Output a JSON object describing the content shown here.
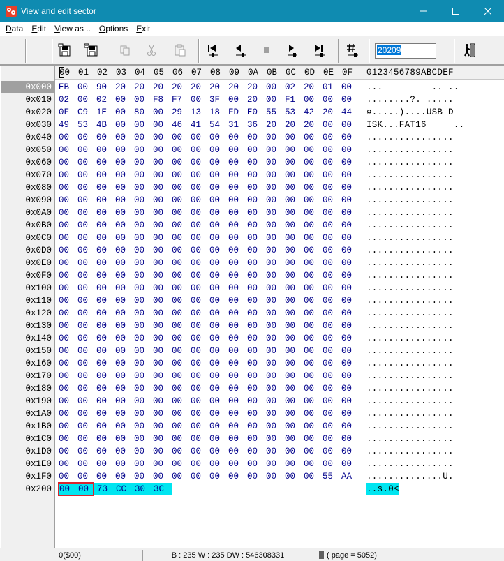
{
  "window": {
    "title": "View and edit sector",
    "app_icon": "app-logo-icon",
    "controls": [
      "minimize-icon",
      "maximize-icon",
      "close-icon"
    ]
  },
  "menu": [
    {
      "label": "Data",
      "u": "D",
      "rest": "ata"
    },
    {
      "label": "Edit",
      "u": "E",
      "rest": "dit"
    },
    {
      "label": "View as ..",
      "u": "V",
      "rest": "iew as .."
    },
    {
      "label": "Options",
      "u": "O",
      "rest": "ptions"
    },
    {
      "label": "Exit",
      "u": "E",
      "rest": "xit"
    }
  ],
  "toolbar": {
    "icons": [
      "save-sector-icon",
      "save-as-icon",
      "copy-icon",
      "cut-icon",
      "paste-icon",
      "first-sector-icon",
      "previous-sector-icon",
      "stop-icon",
      "next-sector-icon",
      "last-sector-icon",
      "goto-sector-icon",
      "exit-door-icon"
    ],
    "sector_value": "20209"
  },
  "header": {
    "columns": [
      "00",
      "01",
      "02",
      "03",
      "04",
      "05",
      "06",
      "07",
      "08",
      "09",
      "0A",
      "0B",
      "0C",
      "0D",
      "0E",
      "0F"
    ],
    "ascii": "0123456789ABCDEF"
  },
  "rows": [
    {
      "addr": "0x000",
      "bytes": [
        "EB",
        "00",
        "90",
        "20",
        "20",
        "20",
        "20",
        "20",
        "20",
        "20",
        "20",
        "00",
        "02",
        "20",
        "01",
        "00"
      ],
      "ascii": "...         .. .."
    },
    {
      "addr": "0x010",
      "bytes": [
        "02",
        "00",
        "02",
        "00",
        "00",
        "F8",
        "F7",
        "00",
        "3F",
        "00",
        "20",
        "00",
        "F1",
        "00",
        "00",
        "00"
      ],
      "ascii": "........?. ....."
    },
    {
      "addr": "0x020",
      "bytes": [
        "0F",
        "C9",
        "1E",
        "00",
        "80",
        "00",
        "29",
        "13",
        "18",
        "FD",
        "E0",
        "55",
        "53",
        "42",
        "20",
        "44"
      ],
      "ascii": "¤.....)....USB D"
    },
    {
      "addr": "0x030",
      "bytes": [
        "49",
        "53",
        "4B",
        "00",
        "00",
        "00",
        "46",
        "41",
        "54",
        "31",
        "36",
        "20",
        "20",
        "20",
        "00",
        "00"
      ],
      "ascii": "ISK...FAT16     .."
    },
    {
      "addr": "0x040",
      "bytes": [
        "00",
        "00",
        "00",
        "00",
        "00",
        "00",
        "00",
        "00",
        "00",
        "00",
        "00",
        "00",
        "00",
        "00",
        "00",
        "00"
      ],
      "ascii": "................"
    },
    {
      "addr": "0x050",
      "bytes": [
        "00",
        "00",
        "00",
        "00",
        "00",
        "00",
        "00",
        "00",
        "00",
        "00",
        "00",
        "00",
        "00",
        "00",
        "00",
        "00"
      ],
      "ascii": "................"
    },
    {
      "addr": "0x060",
      "bytes": [
        "00",
        "00",
        "00",
        "00",
        "00",
        "00",
        "00",
        "00",
        "00",
        "00",
        "00",
        "00",
        "00",
        "00",
        "00",
        "00"
      ],
      "ascii": "................"
    },
    {
      "addr": "0x070",
      "bytes": [
        "00",
        "00",
        "00",
        "00",
        "00",
        "00",
        "00",
        "00",
        "00",
        "00",
        "00",
        "00",
        "00",
        "00",
        "00",
        "00"
      ],
      "ascii": "................"
    },
    {
      "addr": "0x080",
      "bytes": [
        "00",
        "00",
        "00",
        "00",
        "00",
        "00",
        "00",
        "00",
        "00",
        "00",
        "00",
        "00",
        "00",
        "00",
        "00",
        "00"
      ],
      "ascii": "................"
    },
    {
      "addr": "0x090",
      "bytes": [
        "00",
        "00",
        "00",
        "00",
        "00",
        "00",
        "00",
        "00",
        "00",
        "00",
        "00",
        "00",
        "00",
        "00",
        "00",
        "00"
      ],
      "ascii": "................"
    },
    {
      "addr": "0x0A0",
      "bytes": [
        "00",
        "00",
        "00",
        "00",
        "00",
        "00",
        "00",
        "00",
        "00",
        "00",
        "00",
        "00",
        "00",
        "00",
        "00",
        "00"
      ],
      "ascii": "................"
    },
    {
      "addr": "0x0B0",
      "bytes": [
        "00",
        "00",
        "00",
        "00",
        "00",
        "00",
        "00",
        "00",
        "00",
        "00",
        "00",
        "00",
        "00",
        "00",
        "00",
        "00"
      ],
      "ascii": "................"
    },
    {
      "addr": "0x0C0",
      "bytes": [
        "00",
        "00",
        "00",
        "00",
        "00",
        "00",
        "00",
        "00",
        "00",
        "00",
        "00",
        "00",
        "00",
        "00",
        "00",
        "00"
      ],
      "ascii": "................"
    },
    {
      "addr": "0x0D0",
      "bytes": [
        "00",
        "00",
        "00",
        "00",
        "00",
        "00",
        "00",
        "00",
        "00",
        "00",
        "00",
        "00",
        "00",
        "00",
        "00",
        "00"
      ],
      "ascii": "................"
    },
    {
      "addr": "0x0E0",
      "bytes": [
        "00",
        "00",
        "00",
        "00",
        "00",
        "00",
        "00",
        "00",
        "00",
        "00",
        "00",
        "00",
        "00",
        "00",
        "00",
        "00"
      ],
      "ascii": "................"
    },
    {
      "addr": "0x0F0",
      "bytes": [
        "00",
        "00",
        "00",
        "00",
        "00",
        "00",
        "00",
        "00",
        "00",
        "00",
        "00",
        "00",
        "00",
        "00",
        "00",
        "00"
      ],
      "ascii": "................"
    },
    {
      "addr": "0x100",
      "bytes": [
        "00",
        "00",
        "00",
        "00",
        "00",
        "00",
        "00",
        "00",
        "00",
        "00",
        "00",
        "00",
        "00",
        "00",
        "00",
        "00"
      ],
      "ascii": "................"
    },
    {
      "addr": "0x110",
      "bytes": [
        "00",
        "00",
        "00",
        "00",
        "00",
        "00",
        "00",
        "00",
        "00",
        "00",
        "00",
        "00",
        "00",
        "00",
        "00",
        "00"
      ],
      "ascii": "................"
    },
    {
      "addr": "0x120",
      "bytes": [
        "00",
        "00",
        "00",
        "00",
        "00",
        "00",
        "00",
        "00",
        "00",
        "00",
        "00",
        "00",
        "00",
        "00",
        "00",
        "00"
      ],
      "ascii": "................"
    },
    {
      "addr": "0x130",
      "bytes": [
        "00",
        "00",
        "00",
        "00",
        "00",
        "00",
        "00",
        "00",
        "00",
        "00",
        "00",
        "00",
        "00",
        "00",
        "00",
        "00"
      ],
      "ascii": "................"
    },
    {
      "addr": "0x140",
      "bytes": [
        "00",
        "00",
        "00",
        "00",
        "00",
        "00",
        "00",
        "00",
        "00",
        "00",
        "00",
        "00",
        "00",
        "00",
        "00",
        "00"
      ],
      "ascii": "................"
    },
    {
      "addr": "0x150",
      "bytes": [
        "00",
        "00",
        "00",
        "00",
        "00",
        "00",
        "00",
        "00",
        "00",
        "00",
        "00",
        "00",
        "00",
        "00",
        "00",
        "00"
      ],
      "ascii": "................"
    },
    {
      "addr": "0x160",
      "bytes": [
        "00",
        "00",
        "00",
        "00",
        "00",
        "00",
        "00",
        "00",
        "00",
        "00",
        "00",
        "00",
        "00",
        "00",
        "00",
        "00"
      ],
      "ascii": "................"
    },
    {
      "addr": "0x170",
      "bytes": [
        "00",
        "00",
        "00",
        "00",
        "00",
        "00",
        "00",
        "00",
        "00",
        "00",
        "00",
        "00",
        "00",
        "00",
        "00",
        "00"
      ],
      "ascii": "................"
    },
    {
      "addr": "0x180",
      "bytes": [
        "00",
        "00",
        "00",
        "00",
        "00",
        "00",
        "00",
        "00",
        "00",
        "00",
        "00",
        "00",
        "00",
        "00",
        "00",
        "00"
      ],
      "ascii": "................"
    },
    {
      "addr": "0x190",
      "bytes": [
        "00",
        "00",
        "00",
        "00",
        "00",
        "00",
        "00",
        "00",
        "00",
        "00",
        "00",
        "00",
        "00",
        "00",
        "00",
        "00"
      ],
      "ascii": "................"
    },
    {
      "addr": "0x1A0",
      "bytes": [
        "00",
        "00",
        "00",
        "00",
        "00",
        "00",
        "00",
        "00",
        "00",
        "00",
        "00",
        "00",
        "00",
        "00",
        "00",
        "00"
      ],
      "ascii": "................"
    },
    {
      "addr": "0x1B0",
      "bytes": [
        "00",
        "00",
        "00",
        "00",
        "00",
        "00",
        "00",
        "00",
        "00",
        "00",
        "00",
        "00",
        "00",
        "00",
        "00",
        "00"
      ],
      "ascii": "................"
    },
    {
      "addr": "0x1C0",
      "bytes": [
        "00",
        "00",
        "00",
        "00",
        "00",
        "00",
        "00",
        "00",
        "00",
        "00",
        "00",
        "00",
        "00",
        "00",
        "00",
        "00"
      ],
      "ascii": "................"
    },
    {
      "addr": "0x1D0",
      "bytes": [
        "00",
        "00",
        "00",
        "00",
        "00",
        "00",
        "00",
        "00",
        "00",
        "00",
        "00",
        "00",
        "00",
        "00",
        "00",
        "00"
      ],
      "ascii": "................"
    },
    {
      "addr": "0x1E0",
      "bytes": [
        "00",
        "00",
        "00",
        "00",
        "00",
        "00",
        "00",
        "00",
        "00",
        "00",
        "00",
        "00",
        "00",
        "00",
        "00",
        "00"
      ],
      "ascii": "................"
    },
    {
      "addr": "0x1F0",
      "bytes": [
        "00",
        "00",
        "00",
        "00",
        "00",
        "00",
        "00",
        "00",
        "00",
        "00",
        "00",
        "00",
        "00",
        "00",
        "55",
        "AA"
      ],
      "ascii": "..............U."
    },
    {
      "addr": "0x200",
      "bytes": [
        "00",
        "00",
        "73",
        "CC",
        "30",
        "3C"
      ],
      "ascii": "..s.0<"
    }
  ],
  "status": {
    "offset": "0($00)",
    "values": "B : 235 W : 235 DW : 546308331",
    "page": "( page = 5052)"
  },
  "colors": {
    "titlebar": "#0f8bb1",
    "byte_text": "#00008b",
    "highlight": "#00e5f0",
    "selection_box": "#d9262f",
    "selected_address_bg": "#a0a0a0"
  }
}
